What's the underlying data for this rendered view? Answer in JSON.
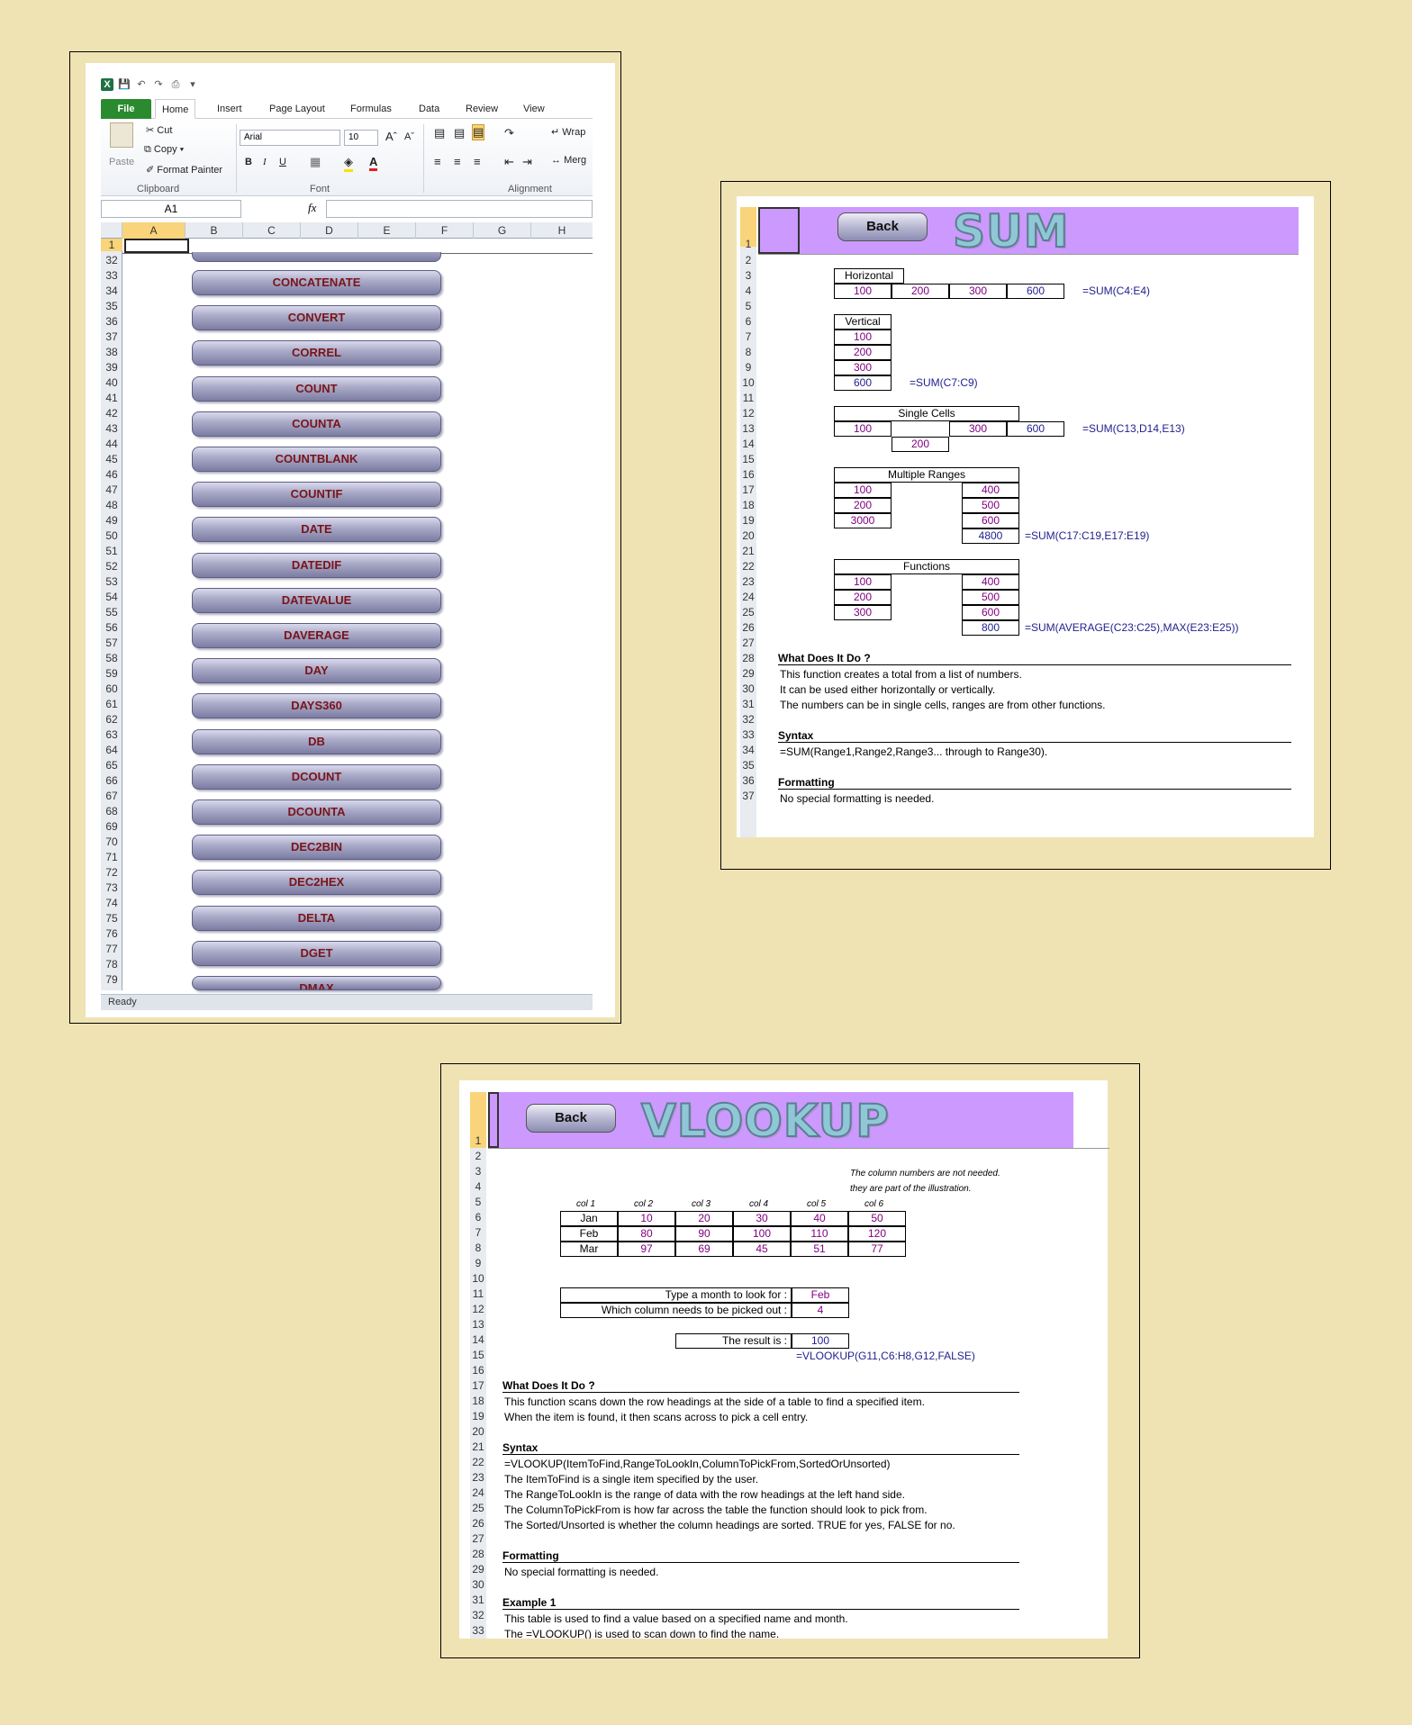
{
  "excel": {
    "tabs": [
      "File",
      "Home",
      "Insert",
      "Page Layout",
      "Formulas",
      "Data",
      "Review",
      "View"
    ],
    "clipboard": {
      "paste": "Paste",
      "cut": "Cut",
      "copy": "Copy",
      "format_painter": "Format Painter",
      "label": "Clipboard"
    },
    "font": {
      "name": "Arial",
      "size": "10",
      "label": "Font",
      "bold": "B",
      "italic": "I",
      "underline": "U"
    },
    "alignment": {
      "label": "Alignment",
      "wrap": "Wrap",
      "merge": "Merg"
    },
    "name_box": "A1",
    "fx": "fx",
    "columns": [
      "A",
      "B",
      "C",
      "D",
      "E",
      "F",
      "G",
      "H"
    ],
    "row_numbers": [
      "1",
      "32",
      "33",
      "34",
      "35",
      "36",
      "37",
      "38",
      "39",
      "40",
      "41",
      "42",
      "43",
      "44",
      "45",
      "46",
      "47",
      "48",
      "49",
      "50",
      "51",
      "52",
      "53",
      "54",
      "55",
      "56",
      "57",
      "58",
      "59",
      "60",
      "61",
      "62",
      "63",
      "64",
      "65",
      "66",
      "67",
      "68",
      "69",
      "70",
      "71",
      "72",
      "73",
      "74",
      "75",
      "76",
      "77",
      "78",
      "79"
    ],
    "buttons": [
      "CONCATENATE",
      "CONVERT",
      "CORREL",
      "COUNT",
      "COUNTA",
      "COUNTBLANK",
      "COUNTIF",
      "DATE",
      "DATEDIF",
      "DATEVALUE",
      "DAVERAGE",
      "DAY",
      "DAYS360",
      "DB",
      "DCOUNT",
      "DCOUNTA",
      "DEC2BIN",
      "DEC2HEX",
      "DELTA",
      "DGET",
      "DMAX"
    ],
    "status": "Ready"
  },
  "sum": {
    "back": "Back",
    "title": "SUM",
    "rows": [
      "1",
      "2",
      "3",
      "4",
      "5",
      "6",
      "7",
      "8",
      "9",
      "10",
      "11",
      "12",
      "13",
      "14",
      "15",
      "16",
      "17",
      "18",
      "19",
      "20",
      "21",
      "22",
      "23",
      "24",
      "25",
      "26",
      "27",
      "28",
      "29",
      "30",
      "31",
      "32",
      "33",
      "34",
      "35",
      "36",
      "37"
    ],
    "horizontal": {
      "label": "Horizontal",
      "values": [
        "100",
        "200",
        "300",
        "600"
      ],
      "formula": "=SUM(C4:E4)"
    },
    "vertical": {
      "label": "Vertical",
      "values": [
        "100",
        "200",
        "300",
        "600"
      ],
      "formula": "=SUM(C7:C9)"
    },
    "single": {
      "label": "Single Cells",
      "c13": "100",
      "d14": "200",
      "e13": "300",
      "f13": "600",
      "formula": "=SUM(C13,D14,E13)"
    },
    "multiple": {
      "label": "Multiple Ranges",
      "left": [
        "100",
        "200",
        "3000"
      ],
      "right": [
        "400",
        "500",
        "600"
      ],
      "total": "4800",
      "formula": "=SUM(C17:C19,E17:E19)"
    },
    "functions": {
      "label": "Functions",
      "left": [
        "100",
        "200",
        "300"
      ],
      "right": [
        "400",
        "500",
        "600"
      ],
      "total": "800",
      "formula": "=SUM(AVERAGE(C23:C25),MAX(E23:E25))"
    },
    "what_title": "What Does It Do ?",
    "what": [
      "This function creates a total from a list of numbers.",
      "It can be used either horizontally or vertically.",
      "The numbers can be in single cells, ranges are from other functions."
    ],
    "syntax_title": "Syntax",
    "syntax": "=SUM(Range1,Range2,Range3... through to Range30).",
    "formatting_title": "Formatting",
    "formatting": "No special formatting is needed."
  },
  "vlookup": {
    "back": "Back",
    "title": "VLOOKUP",
    "rows": [
      "1",
      "2",
      "3",
      "4",
      "5",
      "6",
      "7",
      "8",
      "9",
      "10",
      "11",
      "12",
      "13",
      "14",
      "15",
      "16",
      "17",
      "18",
      "19",
      "20",
      "21",
      "22",
      "23",
      "24",
      "25",
      "26",
      "27",
      "28",
      "29",
      "30",
      "31",
      "32",
      "33"
    ],
    "note": [
      "The column numbers are not needed.",
      "they are part of the illustration."
    ],
    "col_headers": [
      "col 1",
      "col 2",
      "col 3",
      "col 4",
      "col 5",
      "col 6"
    ],
    "table": [
      [
        "Jan",
        "10",
        "20",
        "30",
        "40",
        "50"
      ],
      [
        "Feb",
        "80",
        "90",
        "100",
        "110",
        "120"
      ],
      [
        "Mar",
        "97",
        "69",
        "45",
        "51",
        "77"
      ]
    ],
    "month_label": "Type a month to look for :",
    "month_value": "Feb",
    "col_label": "Which column needs to be picked out :",
    "col_value": "4",
    "result_label": "The result is :",
    "result_value": "100",
    "formula": "=VLOOKUP(G11,C6:H8,G12,FALSE)",
    "what_title": "What Does It Do ?",
    "what": [
      "This function scans down the row headings at the side of a table to find a specified item.",
      "When the item is found, it then scans across to pick a cell entry."
    ],
    "syntax_title": "Syntax",
    "syntax": [
      "=VLOOKUP(ItemToFind,RangeToLookIn,ColumnToPickFrom,SortedOrUnsorted)",
      "The ItemToFind is a single item specified by the user.",
      "The RangeToLookIn is the range of data with the row headings at the left hand side.",
      "The ColumnToPickFrom is how far across the table the function should look to pick from.",
      "The Sorted/Unsorted is whether the column headings are sorted. TRUE for yes, FALSE for no."
    ],
    "formatting_title": "Formatting",
    "formatting": "No special formatting is needed.",
    "example_title": "Example 1",
    "example": [
      "This table is used to find a value based on a specified name and month.",
      "The =VLOOKUP() is used to scan down to find the name."
    ]
  }
}
